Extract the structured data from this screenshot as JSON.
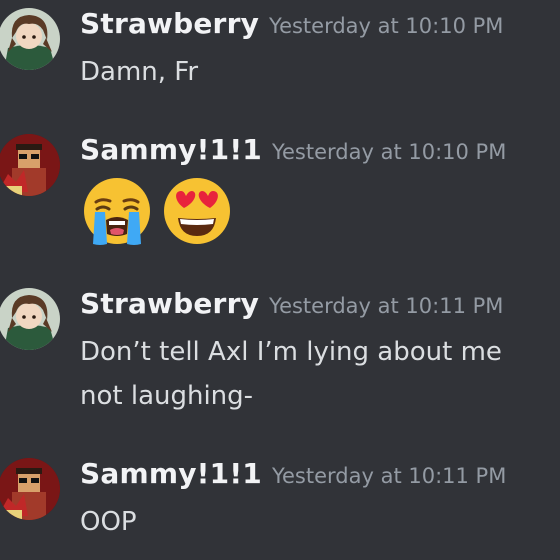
{
  "messages": [
    {
      "author": "Strawberry",
      "timestamp": "Yesterday at 10:10 PM",
      "text": "Damn, Fr",
      "avatar": "strawberry-avatar"
    },
    {
      "author": "Sammy!1!1",
      "timestamp": "Yesterday at 10:10 PM",
      "emojis": [
        "loudly-crying-face",
        "smiling-face-with-heart-eyes"
      ],
      "avatar": "sammy-avatar"
    },
    {
      "author": "Strawberry",
      "timestamp": "Yesterday at 10:11 PM",
      "text": "Don’t tell Axl I’m lying about me not laughing-",
      "avatar": "strawberry-avatar"
    },
    {
      "author": "Sammy!1!1",
      "timestamp": "Yesterday at 10:11 PM",
      "text": "OOP",
      "avatar": "sammy-avatar"
    }
  ],
  "colors": {
    "background": "#313338",
    "username": "#f2f3f5",
    "timestamp": "#949ba4",
    "message_text": "#dbdee1"
  }
}
